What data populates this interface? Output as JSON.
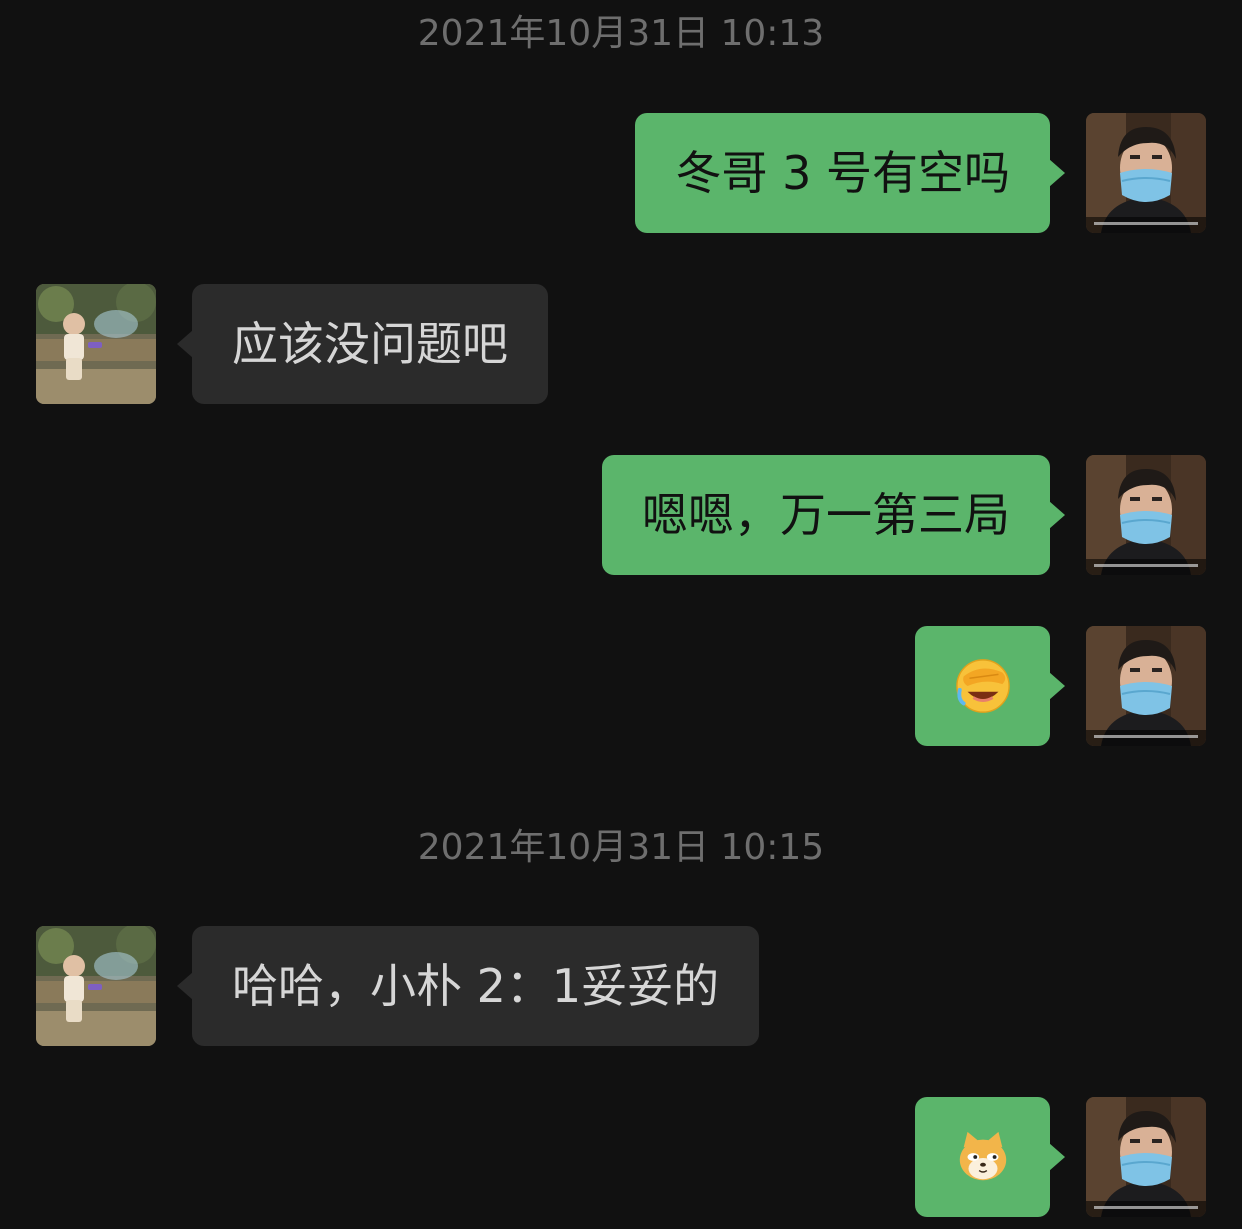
{
  "timestamps": [
    "2021年10月31日 10:13",
    "2021年10月31日 10:15"
  ],
  "messages": [
    {
      "side": "out",
      "type": "text",
      "text": "冬哥 3 号有空吗"
    },
    {
      "side": "in",
      "type": "text",
      "text": "应该没问题吧"
    },
    {
      "side": "out",
      "type": "text",
      "text": "嗯嗯，万一第三局"
    },
    {
      "side": "out",
      "type": "emoji",
      "emoji": "facepalm-laughing-emoji"
    },
    {
      "side": "in",
      "type": "text",
      "text": "哈哈，小朴 2：1妥妥的"
    },
    {
      "side": "out",
      "type": "emoji",
      "emoji": "doge-emoji"
    }
  ],
  "colors": {
    "background": "#111111",
    "outgoing_bubble": "#5bb56b",
    "incoming_bubble": "#2b2b2b",
    "timestamp_text": "#6e6e6e"
  },
  "avatars": {
    "self": "masked-man-avatar",
    "contact": "child-outdoor-avatar"
  }
}
